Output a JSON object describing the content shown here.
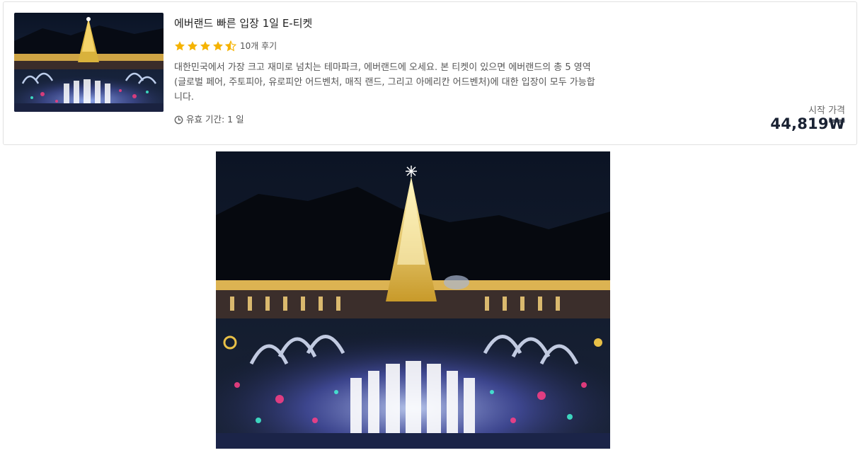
{
  "product": {
    "title": "에버랜드 빠른 입장 1일 E-티켓",
    "rating": 4.5,
    "reviews_label": "10개 후기",
    "description": "대한민국에서 가장 크고 재미로 넘치는 테마파크, 에버랜드에 오세요. 본 티켓이 있으면 에버랜드의 총 5 영역(글로벌 페어, 주토피아, 유로피안 어드벤처, 매직 랜드, 그리고 아메리칸 어드벤처)에 대한 입장이 모두 가능합니다.",
    "validity_label": "유효 기간: 1 일",
    "price_label": "시작 가격",
    "price": "44,819₩"
  },
  "colors": {
    "star": "#f5b301",
    "price": "#1a2233",
    "border": "#e1e1e1"
  },
  "icons": {
    "rating": "star-icon",
    "validity": "clock-icon"
  }
}
